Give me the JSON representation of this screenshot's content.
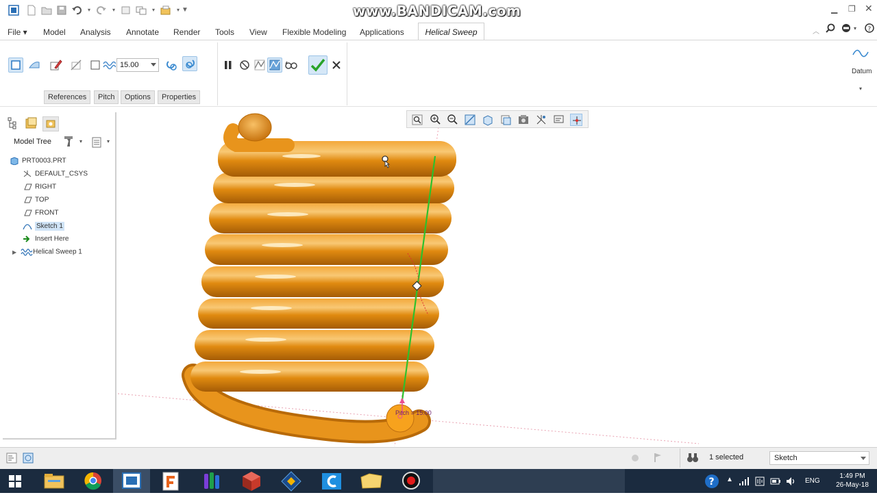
{
  "watermark": "www.BANDICAM.com",
  "ribbon": {
    "tabs": [
      "File",
      "Model",
      "Analysis",
      "Annotate",
      "Render",
      "Tools",
      "View",
      "Flexible Modeling",
      "Applications"
    ],
    "active_tab": "Helical Sweep"
  },
  "dashboard": {
    "pitch_value": "15.00",
    "subtabs": [
      "References",
      "Pitch",
      "Options",
      "Properties"
    ],
    "datum_label": "Datum"
  },
  "model_tree": {
    "title": "Model Tree",
    "items": [
      {
        "label": "PRT0003.PRT",
        "icon": "part-icon"
      },
      {
        "label": "DEFAULT_CSYS",
        "icon": "csys-icon"
      },
      {
        "label": "RIGHT",
        "icon": "plane-icon"
      },
      {
        "label": "TOP",
        "icon": "plane-icon"
      },
      {
        "label": "FRONT",
        "icon": "plane-icon"
      },
      {
        "label": "Sketch 1",
        "icon": "sketch-icon"
      },
      {
        "label": "Insert Here",
        "icon": "insert-arrow-icon"
      },
      {
        "label": "Helical Sweep 1",
        "icon": "helical-sweep-icon"
      }
    ]
  },
  "viewport": {
    "pitch_label": "Pitch = 15.00"
  },
  "status": {
    "selected": "1 selected",
    "filter": "Sketch"
  },
  "taskbar": {
    "language": "ENG",
    "time": "1:49 PM",
    "date": "26-May-18"
  },
  "colors": {
    "spring": "#e08a10",
    "axis": "#2cc12c",
    "accent": "#2a78c4",
    "taskbar": "#1b2b3f"
  }
}
